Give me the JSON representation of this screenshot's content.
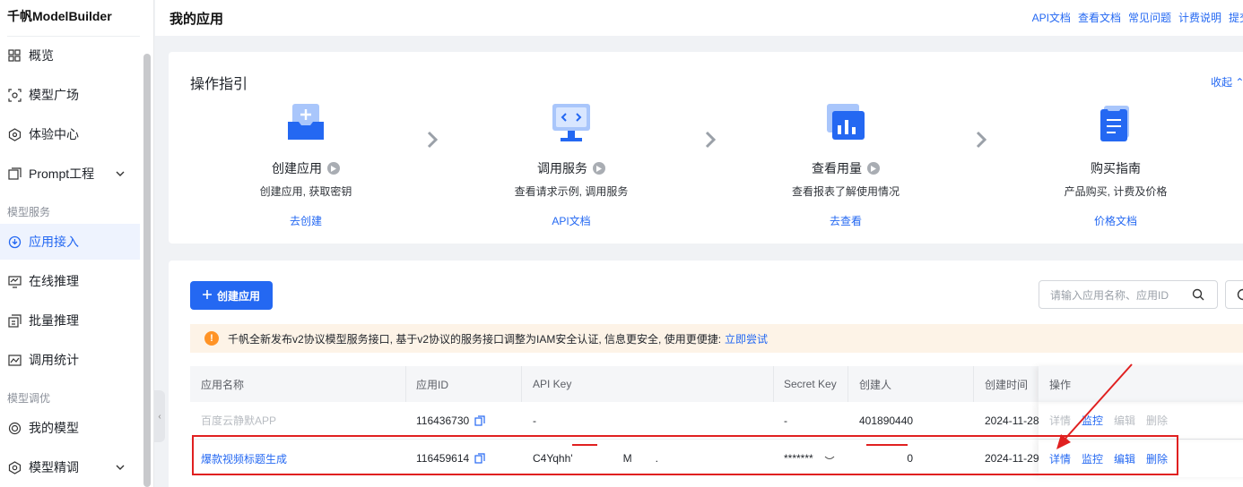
{
  "app": {
    "brand": "千帆ModelBuilder"
  },
  "sidebar": {
    "items": [
      {
        "label": "概览",
        "icon": "grid-icon"
      },
      {
        "label": "模型广场",
        "icon": "cube-scan-icon"
      },
      {
        "label": "体验中心",
        "icon": "hexagon-icon"
      },
      {
        "label": "Prompt工程",
        "icon": "prompt-icon"
      },
      {
        "label": "应用接入",
        "icon": "access-icon",
        "active": true
      },
      {
        "label": "在线推理",
        "icon": "monitor-icon"
      },
      {
        "label": "批量推理",
        "icon": "batch-icon"
      },
      {
        "label": "调用统计",
        "icon": "stats-icon"
      },
      {
        "label": "我的模型",
        "icon": "target-icon"
      },
      {
        "label": "模型精调",
        "icon": "tune-icon"
      }
    ],
    "groups": {
      "model_service": "模型服务",
      "model_tuning": "模型调优"
    }
  },
  "header": {
    "title": "我的应用",
    "links": [
      "API文档",
      "查看文档",
      "常见问题",
      "计费说明",
      "提交"
    ]
  },
  "guide": {
    "title": "操作指引",
    "collapse_label": "收起",
    "steps": [
      {
        "title": "创建应用",
        "desc": "创建应用, 获取密钥",
        "link": "去创建",
        "has_video": true
      },
      {
        "title": "调用服务",
        "desc": "查看请求示例, 调用服务",
        "link": "API文档",
        "has_video": true
      },
      {
        "title": "查看用量",
        "desc": "查看报表了解使用情况",
        "link": "去查看",
        "has_video": true
      },
      {
        "title": "购买指南",
        "desc": "产品购买, 计费及价格",
        "link": "价格文档",
        "has_video": false
      }
    ]
  },
  "apps": {
    "create_label": "创建应用",
    "search_placeholder": "请输入应用名称、应用ID",
    "notice": {
      "text": "千帆全新发布v2协议模型服务接口, 基于v2协议的服务接口调整为IAM安全认证, 信息更安全, 使用更便捷:",
      "link": "立即尝试"
    },
    "columns": [
      "应用名称",
      "应用ID",
      "API Key",
      "Secret Key",
      "创建人",
      "创建时间",
      "操作"
    ],
    "rows": [
      {
        "name": "百度云静默APP",
        "id": "116436730",
        "api_key": "-",
        "secret_key": "-",
        "creator": "401890440",
        "created": "2024-11-28",
        "ops": [
          "详情",
          "监控",
          "编辑",
          "删除"
        ],
        "disabled": true
      },
      {
        "name": "爆款视频标题生成",
        "id": "116459614",
        "api_key": "C4Yqhh'",
        "api_key_tail": "M",
        "api_key_dot": ".",
        "secret_key": "*******",
        "creator": "0",
        "created": "2024-11-29",
        "ops": [
          "详情",
          "监控",
          "编辑",
          "删除"
        ],
        "disabled": false
      }
    ]
  },
  "colors": {
    "accent": "#2468f2",
    "annotation": "#e02020",
    "warning": "#ff9326"
  }
}
